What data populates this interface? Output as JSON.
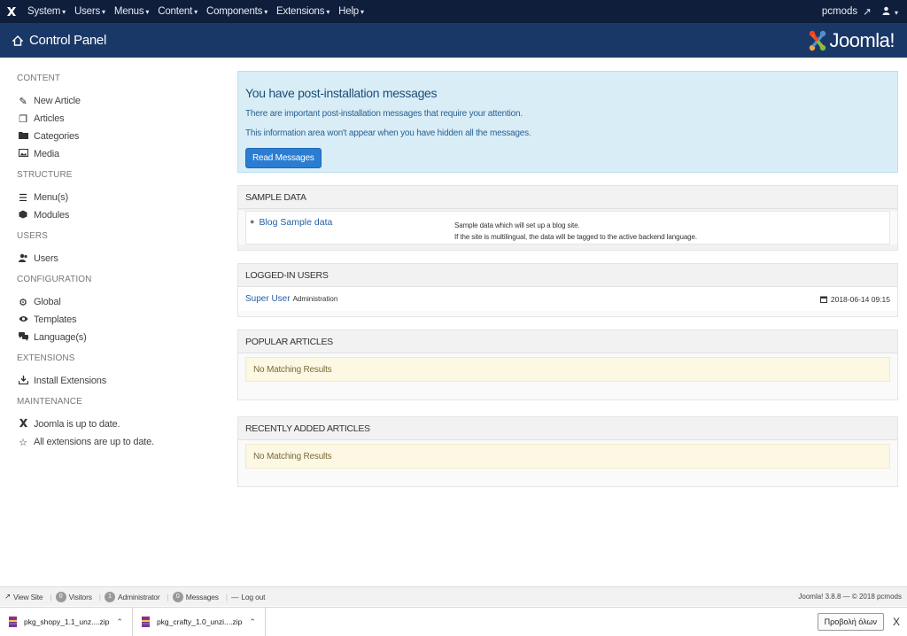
{
  "navbar": {
    "menu": [
      "System",
      "Users",
      "Menus",
      "Content",
      "Components",
      "Extensions",
      "Help"
    ],
    "site_name": "pcmods",
    "site_icon": "external-link-icon",
    "user_icon": "user-icon"
  },
  "header": {
    "title": "Control Panel",
    "logo_text": "Joomla!"
  },
  "sidebar": {
    "groups": [
      {
        "heading": "CONTENT",
        "items": [
          {
            "label": "New Article",
            "icon": "pencil-icon"
          },
          {
            "label": "Articles",
            "icon": "stack-icon"
          },
          {
            "label": "Categories",
            "icon": "folder-icon"
          },
          {
            "label": "Media",
            "icon": "image-icon"
          }
        ]
      },
      {
        "heading": "STRUCTURE",
        "items": [
          {
            "label": "Menu(s)",
            "icon": "list-icon"
          },
          {
            "label": "Modules",
            "icon": "cube-icon"
          }
        ]
      },
      {
        "heading": "USERS",
        "items": [
          {
            "label": "Users",
            "icon": "users-icon"
          }
        ]
      },
      {
        "heading": "CONFIGURATION",
        "items": [
          {
            "label": "Global",
            "icon": "gear-icon"
          },
          {
            "label": "Templates",
            "icon": "eye-icon"
          },
          {
            "label": "Language(s)",
            "icon": "comments-icon"
          }
        ]
      },
      {
        "heading": "EXTENSIONS",
        "items": [
          {
            "label": "Install Extensions",
            "icon": "upload-icon"
          }
        ]
      },
      {
        "heading": "MAINTENANCE",
        "items": [
          {
            "label": "Joomla is up to date.",
            "icon": "joomla-icon"
          },
          {
            "label": "All extensions are up to date.",
            "icon": "star-icon"
          }
        ]
      }
    ]
  },
  "postinstall": {
    "title": "You have post-installation messages",
    "line1": "There are important post-installation messages that require your attention.",
    "line2": "This information area won't appear when you have hidden all the messages.",
    "button": "Read Messages"
  },
  "sample_data": {
    "heading": "SAMPLE DATA",
    "link": "Blog Sample data",
    "desc1": "Sample data which will set up a blog site.",
    "desc2": "If the site is multilingual, the data will be tagged to the active backend language."
  },
  "logged_in": {
    "heading": "LOGGED-IN USERS",
    "user": "Super User",
    "role": "Administration",
    "date": "2018-06-14 09:15"
  },
  "popular": {
    "heading": "POPULAR ARTICLES",
    "empty": "No Matching Results"
  },
  "recent": {
    "heading": "RECENTLY ADDED ARTICLES",
    "empty": "No Matching Results"
  },
  "status": {
    "view_site": "View Site",
    "visitors_count": "0",
    "visitors": "Visitors",
    "admin_count": "1",
    "administrator": "Administrator",
    "messages_count": "0",
    "messages": "Messages",
    "logout": "Log out",
    "version": "Joomla! 3.8.8 — © 2018 pcmods"
  },
  "downloads": {
    "files": [
      "pkg_shopy_1.1_unz....zip",
      "pkg_crafty_1.0_unzi....zip"
    ],
    "show_all": "Προβολή όλων",
    "close": "X"
  }
}
